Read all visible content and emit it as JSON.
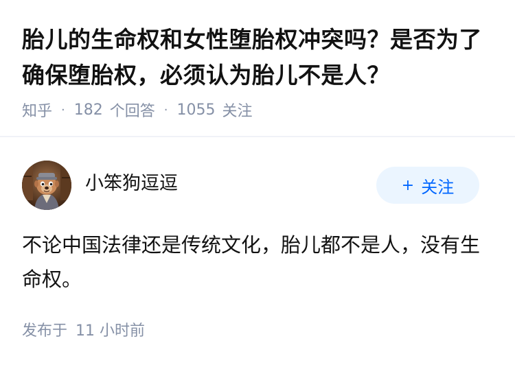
{
  "question": {
    "title": "胎儿的生命权和女性堕胎权冲突吗？是否为了确保堕胎权，必须认为胎儿不是人？",
    "source": "知乎",
    "answer_count": "182",
    "answer_label": "个回答",
    "follower_count": "1055",
    "follower_label": "关注"
  },
  "answer": {
    "author": {
      "name": "小笨狗逗逗"
    },
    "follow_button_label": "关注",
    "content": "不论中国法律还是传统文化，胎儿都不是人，没有生命权。",
    "time_prefix": "发布于",
    "time_value": "11 小时前"
  },
  "colors": {
    "accent": "#0066ff",
    "accent_bg": "#ebf5ff",
    "meta_text": "#8590a6",
    "primary_text": "#121212",
    "divider": "#f0f2f7"
  },
  "icons": {
    "avatar": "cartoon-character-avatar",
    "follow": "plus-icon"
  }
}
